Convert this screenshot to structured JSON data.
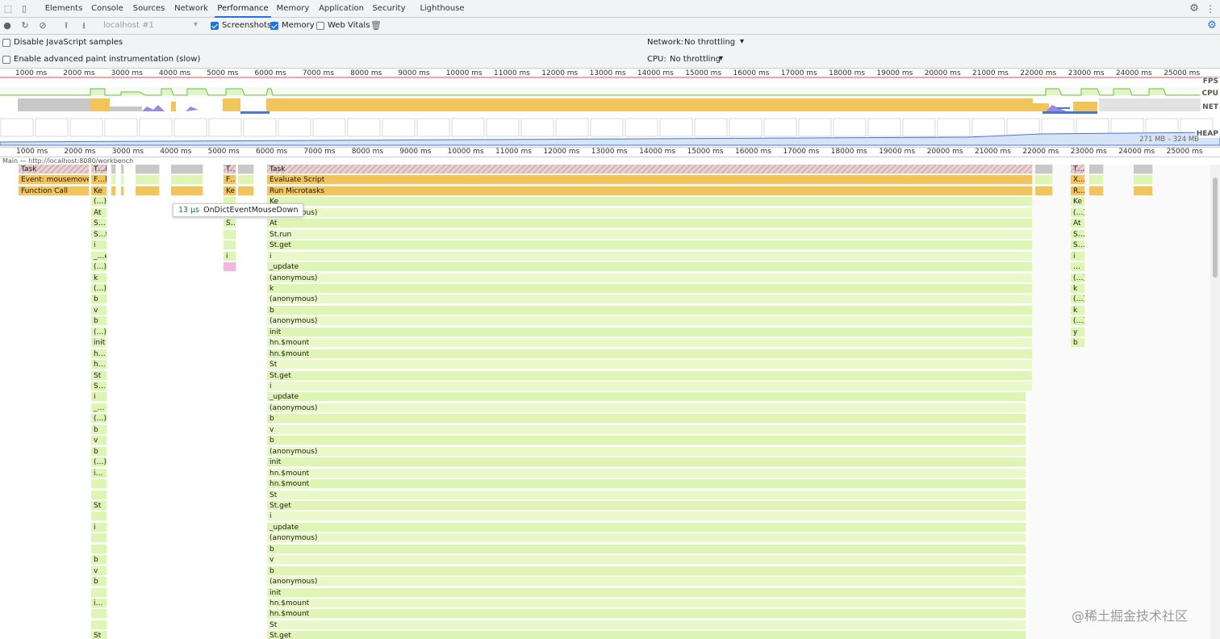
{
  "tabs": [
    "Elements",
    "Console",
    "Sources",
    "Network",
    "Performance",
    "Memory",
    "Application",
    "Security",
    "Lighthouse"
  ],
  "active_tab": "Performance",
  "toolbar": {
    "target": "localhost #1",
    "screenshots_label": "Screenshots",
    "memory_label": "Memory",
    "web_vitals_label": "Web Vitals",
    "screenshots_checked": true,
    "memory_checked": true,
    "web_vitals_checked": false
  },
  "settings": {
    "disable_js_samples": "Disable JavaScript samples",
    "advanced_paint": "Enable advanced paint instrumentation (slow)",
    "network_label": "Network:",
    "network_value": "No throttling",
    "cpu_label": "CPU:",
    "cpu_value": "No throttling"
  },
  "ruler_ticks": [
    "1000 ms",
    "2000 ms",
    "3000 ms",
    "4000 ms",
    "5000 ms",
    "6000 ms",
    "7000 ms",
    "8000 ms",
    "9000 ms",
    "10000 ms",
    "11000 ms",
    "12000 ms",
    "13000 ms",
    "14000 ms",
    "15000 ms",
    "16000 ms",
    "17000 ms",
    "18000 ms",
    "19000 ms",
    "20000 ms",
    "21000 ms",
    "22000 ms",
    "23000 ms",
    "24000 ms",
    "25000 ms"
  ],
  "tracks": {
    "fps": "FPS",
    "cpu": "CPU",
    "net": "NET",
    "heap": "HEAP"
  },
  "heap_range": "271 MB – 324 MB",
  "main_thread_label": "Main — http://localhost:8080/workbench",
  "flame": {
    "c1": [
      "Task",
      "Event: mousemove",
      "Function Call"
    ],
    "c2": [
      "T…k",
      "F…l",
      "Ke",
      "(…)",
      "At",
      "S…",
      "S…t",
      "i",
      "_…e",
      "(…)",
      "k",
      "(…)",
      "b",
      "v",
      "b",
      "(…)",
      "init",
      "h…",
      "h…",
      "St",
      "S…",
      "i",
      "_…",
      "(…)",
      "b",
      "v",
      "b",
      "(…)",
      "i…",
      "",
      "",
      "St",
      "",
      "i",
      "",
      "",
      "b",
      "v",
      "b",
      "",
      "i…",
      "",
      "",
      "St"
    ],
    "c3": [
      "T…",
      "F…",
      "Ke",
      "",
      "",
      "S…",
      "",
      "",
      "i"
    ],
    "c4": [
      "Task",
      "Evaluate Script",
      "Run Microtasks",
      "Ke",
      "(anonymous)",
      "At",
      "St.run",
      "St.get",
      "i",
      "_update",
      "(anonymous)",
      "k",
      "(anonymous)",
      "b",
      "(anonymous)",
      "init",
      "hn.$mount",
      "hn.$mount",
      "St",
      "St.get",
      "i",
      "_update",
      "(anonymous)",
      "b",
      "v",
      "b",
      "(anonymous)",
      "init",
      "hn.$mount",
      "hn.$mount",
      "St",
      "St.get",
      "i",
      "_update",
      "(anonymous)",
      "b",
      "v",
      "b",
      "(anonymous)",
      "init",
      "hn.$mount",
      "hn.$mount",
      "St",
      "St.get"
    ],
    "c5": [
      "T…",
      "X…",
      "R…",
      "Ke",
      "(…)",
      "At",
      "S…",
      "S…",
      "i",
      "…",
      "(…)",
      "k",
      "(…)",
      "k",
      "(…)",
      "y",
      "b"
    ]
  },
  "tooltip": {
    "duration": "13 µs",
    "name": "OnDictEventMouseDown"
  },
  "watermark": "@稀土掘金技术社区"
}
